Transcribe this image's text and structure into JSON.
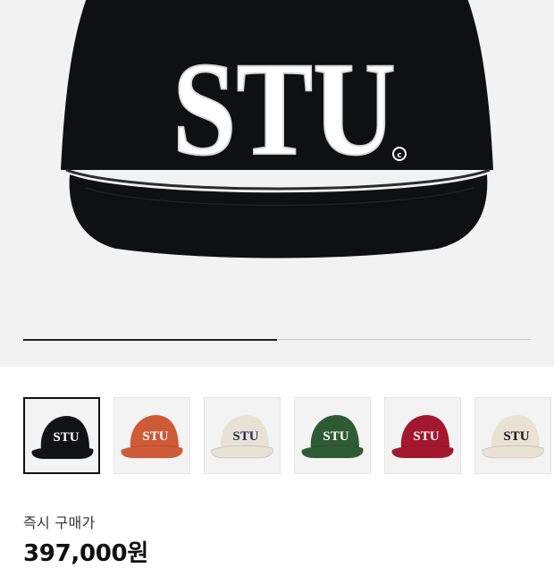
{
  "product": {
    "hero_logo": "STU",
    "hero_logo_color": "#ffffff",
    "hero_cap_color": "#0f1011",
    "gallery_progress": 0.5
  },
  "thumbnails": [
    {
      "label": "STU",
      "cap_color": "#111315",
      "logo_color": "#ffffff",
      "selected": true
    },
    {
      "label": "STU",
      "cap_color": "#cf5a36",
      "logo_color": "#ffffff",
      "selected": false
    },
    {
      "label": "STU",
      "cap_color": "#e8e1d6",
      "logo_color": "#1f2d4f",
      "selected": false
    },
    {
      "label": "STU",
      "cap_color": "#2e5b33",
      "logo_color": "#ffffff",
      "selected": false
    },
    {
      "label": "STU",
      "cap_color": "#a3182f",
      "logo_color": "#ffffff",
      "selected": false
    },
    {
      "label": "STU",
      "cap_color": "#e9e2d2",
      "logo_color": "#111111",
      "selected": false
    }
  ],
  "pricing": {
    "label": "즉시 구매가",
    "price": "397,000원"
  }
}
